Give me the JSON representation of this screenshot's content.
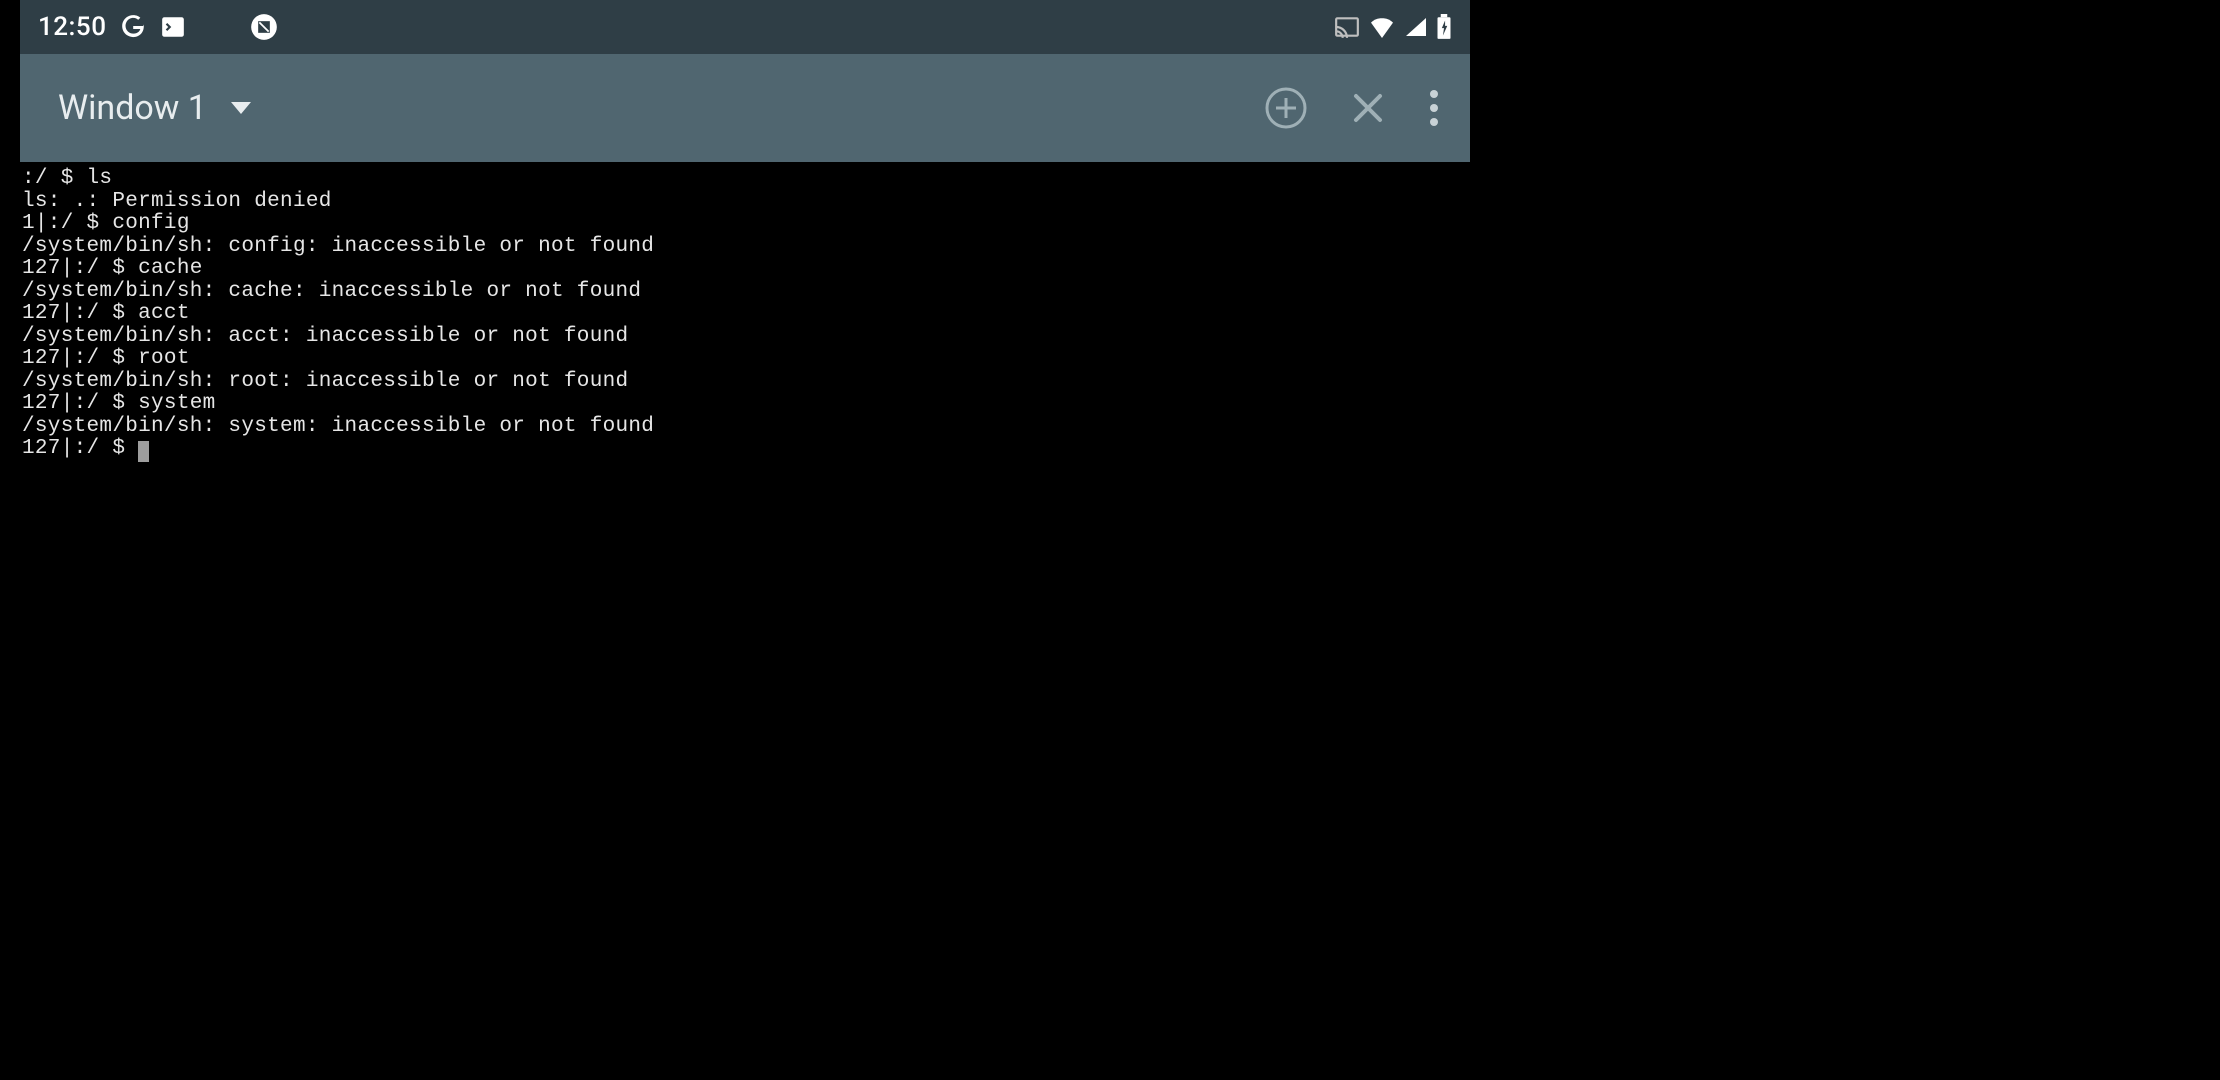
{
  "status_bar": {
    "time": "12:50"
  },
  "app_bar": {
    "window_title": "Window 1"
  },
  "terminal": {
    "lines": [
      ":/ $ ls",
      "ls: .: Permission denied",
      "1|:/ $ config",
      "/system/bin/sh: config: inaccessible or not found",
      "127|:/ $ cache",
      "/system/bin/sh: cache: inaccessible or not found",
      "127|:/ $ acct",
      "/system/bin/sh: acct: inaccessible or not found",
      "127|:/ $ root",
      "/system/bin/sh: root: inaccessible or not found",
      "127|:/ $ system",
      "/system/bin/sh: system: inaccessible or not found"
    ],
    "prompt": "127|:/ $ "
  }
}
